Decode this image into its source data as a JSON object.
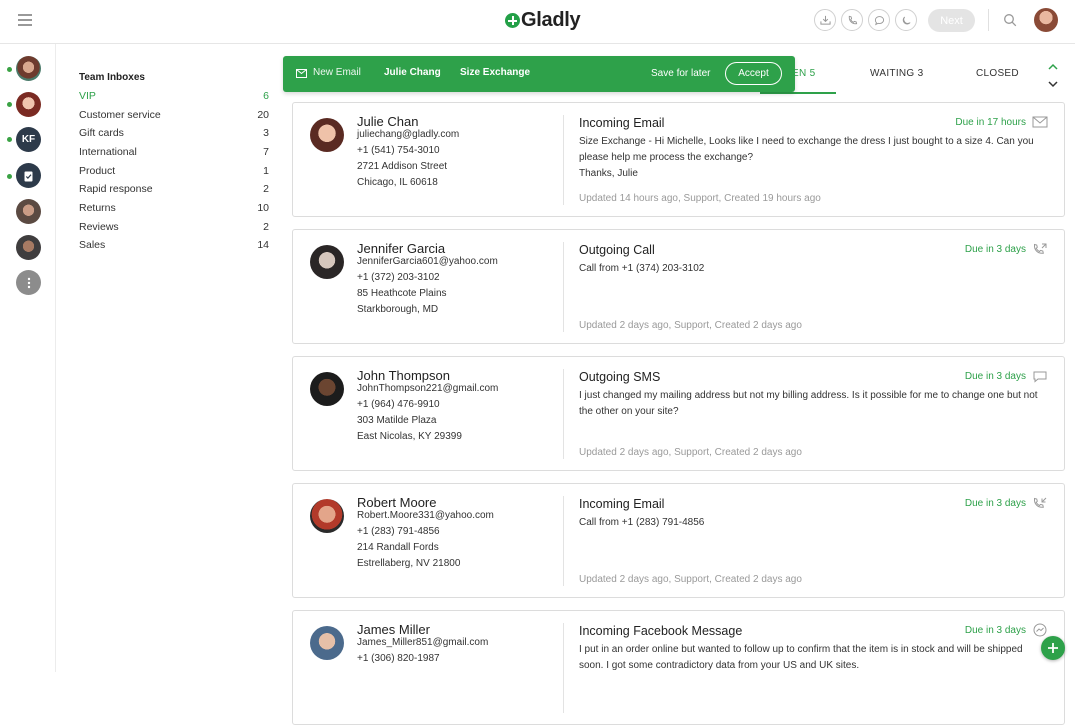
{
  "header": {
    "logo_text": "Gladly",
    "next_label": "Next",
    "icons": [
      "inbox-download-icon",
      "phone-icon",
      "chat-bubble-icon",
      "moon-icon",
      "search-icon"
    ]
  },
  "rail": {
    "kf_initials": "KF"
  },
  "inboxes": {
    "title": "Team Inboxes",
    "items": [
      {
        "label": "VIP",
        "count": "6"
      },
      {
        "label": "Customer service",
        "count": "20"
      },
      {
        "label": "Gift cards",
        "count": "3"
      },
      {
        "label": "International",
        "count": "7"
      },
      {
        "label": "Product",
        "count": "1"
      },
      {
        "label": "Rapid response",
        "count": "2"
      },
      {
        "label": "Returns",
        "count": "10"
      },
      {
        "label": "Reviews",
        "count": "2"
      },
      {
        "label": "Sales",
        "count": "14"
      }
    ]
  },
  "tabs": {
    "open": "EN  5",
    "waiting": "WAITING   3",
    "closed": "CLOSED"
  },
  "notification": {
    "channel_label": "New Email",
    "customer": "Julie Chang",
    "subject": "Size Exchange",
    "later_label": "Save for later",
    "accept_label": "Accept"
  },
  "conversations": [
    {
      "name": "Julie Chan",
      "email": "juliechang@gladly.com",
      "phone": "+1 (541) 754-3010",
      "address1": "2721 Addison Street",
      "address2": "Chicago, IL 60618",
      "type": "Incoming Email",
      "body": "Size Exchange - Hi Michelle, Looks like I need to exchange the dress I just bought to a size 4. Can you please help me process the exchange?",
      "body2": "Thanks, Julie",
      "due": "Due in 17 hours",
      "channel_icon": "envelope-icon",
      "meta": "Updated 14 hours ago, Support, Created 19 hours ago"
    },
    {
      "name": "Jennifer Garcia",
      "email": "JenniferGarcia601@yahoo.com",
      "phone": "+1 (372) 203-3102",
      "address1": "85 Heathcote Plains",
      "address2": "Starkborough, MD",
      "type": "Outgoing Call",
      "body": "Call from +1 (374) 203-3102",
      "body2": "",
      "due": "Due in 3 days",
      "channel_icon": "phone-outgoing-icon",
      "meta": "Updated 2 days ago, Support, Created 2 days ago"
    },
    {
      "name": "John Thompson",
      "email": "JohnThompson221@gmail.com",
      "phone": "+1 (964) 476-9910",
      "address1": "303 Matilde Plaza",
      "address2": "East Nicolas, KY 29399",
      "type": "Outgoing SMS",
      "body": "I just changed my mailing address but not my billing address. Is it possible for me to change one but not the other on your site?",
      "body2": "",
      "due": "Due in 3 days",
      "channel_icon": "sms-icon",
      "meta": "Updated 2 days ago, Support, Created 2 days ago"
    },
    {
      "name": "Robert Moore",
      "email": "Robert.Moore331@yahoo.com",
      "phone": "+1 (283) 791-4856",
      "address1": "214 Randall Fords",
      "address2": "Estrellaberg, NV 21800",
      "type": "Incoming Email",
      "body": "Call from +1 (283) 791-4856",
      "body2": "",
      "due": "Due in 3 days",
      "channel_icon": "phone-incoming-icon",
      "meta": "Updated 2 days ago, Support, Created 2 days ago"
    },
    {
      "name": "James Miller",
      "email": "James_Miller851@gmail.com",
      "phone": "+1 (306) 820-1987",
      "address1": "",
      "address2": "",
      "type": "Incoming Facebook Message",
      "body": "I put in an order online but wanted to follow up to confirm that the item is in stock and will be shipped soon. I got some contradictory data from your US and UK sites.",
      "body2": "",
      "due": "Due in 3 days",
      "channel_icon": "messenger-icon",
      "meta": ""
    }
  ],
  "colors": {
    "accent": "#2ea14a",
    "rail_dark": "#2d3a4a"
  }
}
